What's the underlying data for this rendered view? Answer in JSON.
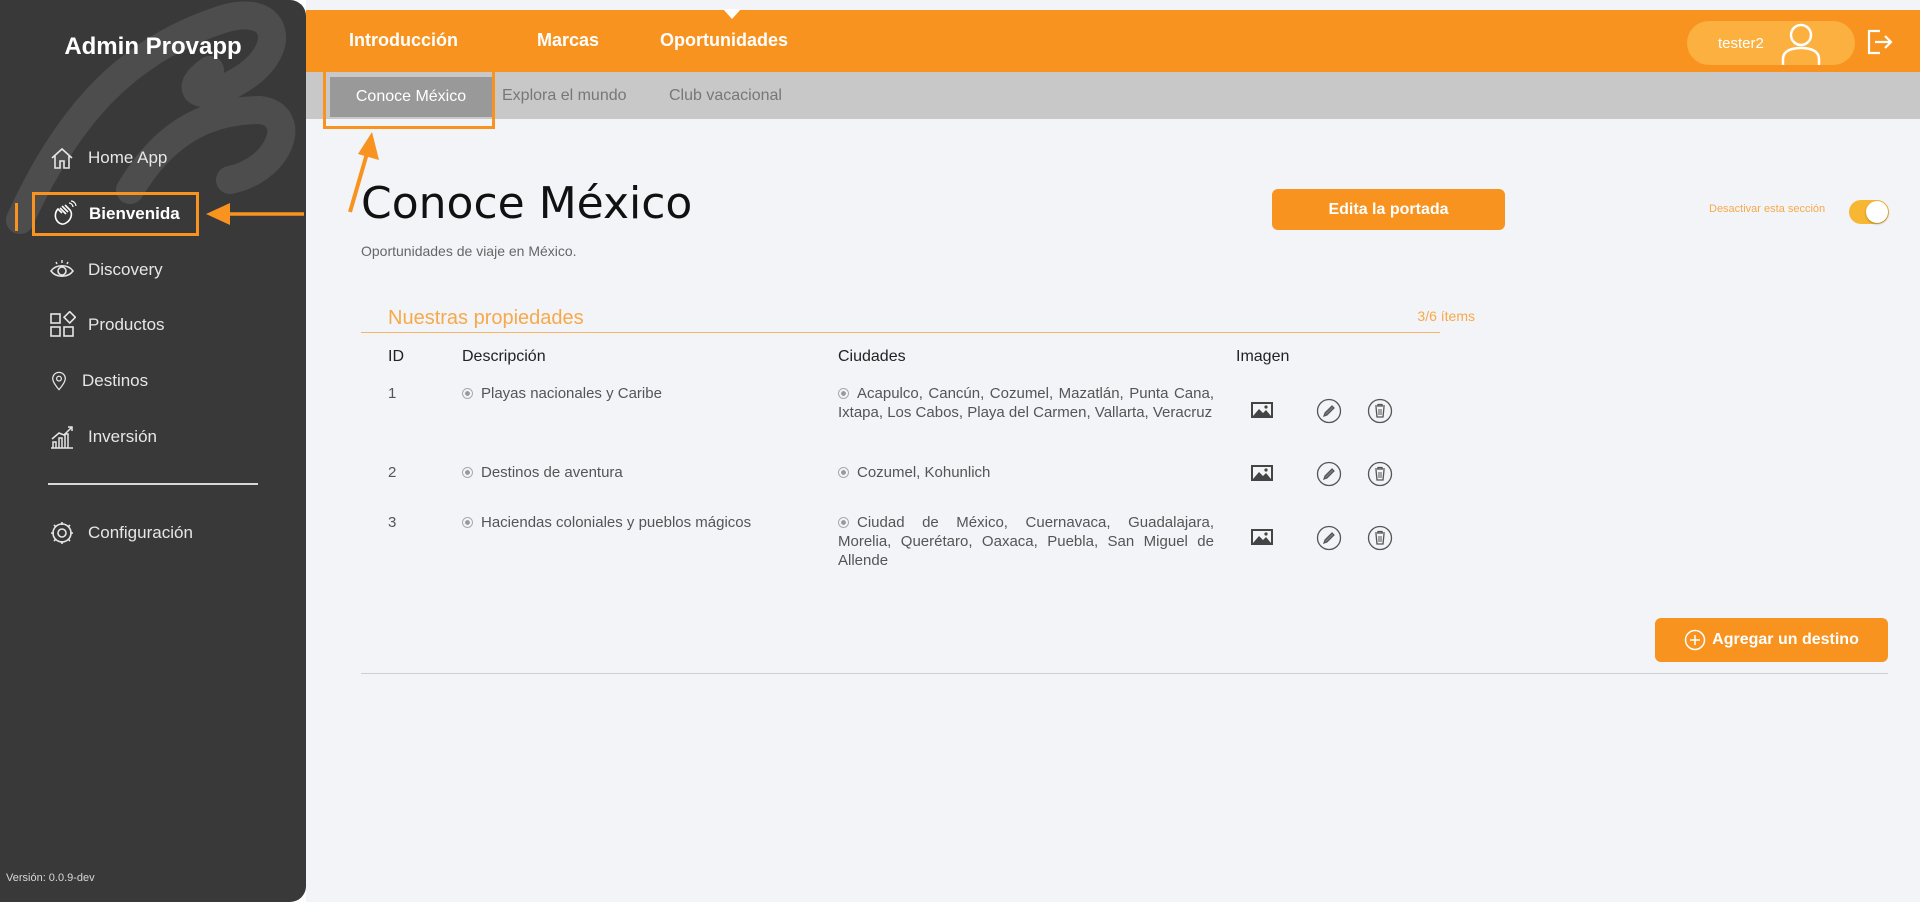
{
  "sidebar": {
    "brand": "Admin Provapp",
    "items": [
      {
        "label": "Home App",
        "icon": "home-icon"
      },
      {
        "label": "Bienvenida",
        "icon": "waving-hand-icon",
        "active": true
      },
      {
        "label": "Discovery",
        "icon": "eye-icon"
      },
      {
        "label": "Productos",
        "icon": "grid-icon"
      },
      {
        "label": "Destinos",
        "icon": "map-pin-icon"
      },
      {
        "label": "Inversión",
        "icon": "growth-chart-icon"
      }
    ],
    "config": {
      "label": "Configuración",
      "icon": "gear-icon"
    },
    "version": "Versión: 0.0.9-dev"
  },
  "topbar": {
    "tabs": [
      "Introducción",
      "Marcas",
      "Oportunidades"
    ],
    "user": "tester2"
  },
  "subbar": {
    "tabs": [
      "Conoce México",
      "Explora el mundo",
      "Club vacacional"
    ]
  },
  "page": {
    "title": "Conoce México",
    "subtitle": "Oportunidades de viaje en México.",
    "edit_button": "Edita la portada",
    "toggle_label": "Desactivar esta sección",
    "section_title": "Nuestras propiedades",
    "section_count": "3/6 ítems",
    "add_button": "Agregar un destino"
  },
  "table": {
    "headers": [
      "ID",
      "Descripción",
      "Ciudades",
      "Imagen"
    ],
    "rows": [
      {
        "id": "1",
        "description": "Playas nacionales y Caribe",
        "cities": "Acapulco, Cancún, Cozumel, Mazatlán, Punta Cana, Ixtapa, Los Cabos, Playa del Carmen, Vallarta, Veracruz"
      },
      {
        "id": "2",
        "description": "Destinos de aventura",
        "cities": "Cozumel, Kohunlich"
      },
      {
        "id": "3",
        "description": "Haciendas coloniales y pueblos mágicos",
        "cities": "Ciudad de México, Cuernavaca, Guadalajara, Morelia, Querétaro, Oaxaca, Puebla, San Miguel de Allende"
      }
    ]
  },
  "colors": {
    "accent": "#f7931e",
    "sidebar": "#393939",
    "subbar": "#c8c8c8"
  }
}
